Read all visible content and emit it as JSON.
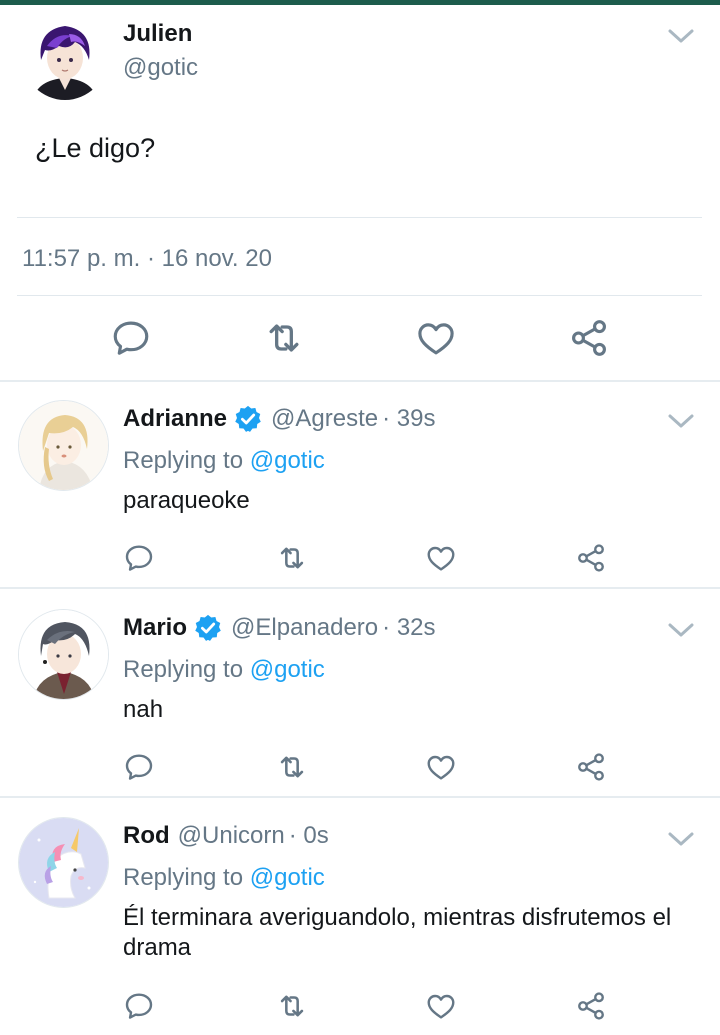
{
  "main_tweet": {
    "name": "Julien",
    "handle": "@gotic",
    "text": "¿Le digo?",
    "timestamp": "11:57 p. m. · 16 nov. 20",
    "avatar_icon": "purple-hair-character-avatar"
  },
  "colors": {
    "text_primary": "#14171a",
    "text_secondary": "#657786",
    "mention": "#1da1f2",
    "verified": "#1da1f2",
    "top_bar": "#1d5c4c",
    "divider": "#e1e8ed"
  },
  "replies": [
    {
      "name": "Adrianne",
      "verified": true,
      "handle": "@Agreste",
      "age": "· 39s",
      "replying_prefix": "Replying to",
      "replying_mention": "@gotic",
      "text": "paraqueoke"
    },
    {
      "name": "Mario",
      "verified": true,
      "handle": "@Elpanadero",
      "age": "· 32s",
      "replying_prefix": "Replying to",
      "replying_mention": "@gotic",
      "text": "nah"
    },
    {
      "name": "Rod",
      "verified": false,
      "handle": "@Unicorn",
      "age": "· 0s",
      "replying_prefix": "Replying to",
      "replying_mention": "@gotic",
      "text": "Él terminara averiguandolo, mientras disfrutemos el drama"
    }
  ],
  "icons": {
    "reply": "reply-icon",
    "retweet": "retweet-icon",
    "like": "like-icon",
    "share": "share-icon",
    "menu": "chevron-down-icon",
    "verified": "verified-badge-icon"
  }
}
